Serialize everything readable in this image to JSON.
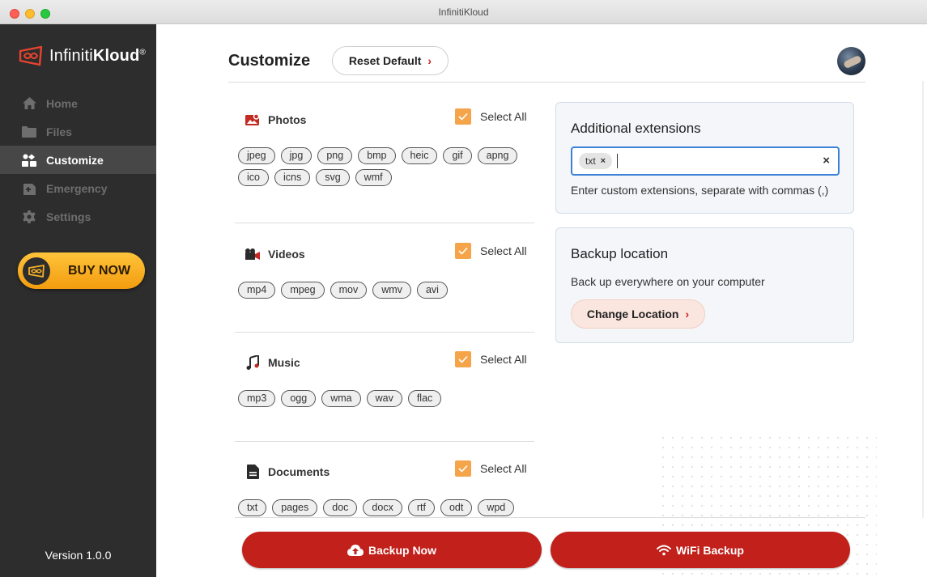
{
  "window": {
    "title": "InfinitiKloud"
  },
  "brand": {
    "name_light": "Infiniti",
    "name_bold": "Kloud",
    "mark": "®"
  },
  "sidebar": {
    "items": [
      {
        "label": "Home",
        "icon": "home-icon",
        "active": false
      },
      {
        "label": "Files",
        "icon": "folder-icon",
        "active": false
      },
      {
        "label": "Customize",
        "icon": "customize-icon",
        "active": true
      },
      {
        "label": "Emergency",
        "icon": "emergency-icon",
        "active": false
      },
      {
        "label": "Settings",
        "icon": "gear-icon",
        "active": false
      }
    ],
    "buy_label": "BUY NOW",
    "version": "Version 1.0.0"
  },
  "header": {
    "title": "Customize",
    "reset_label": "Reset Default",
    "chevron": "›"
  },
  "categories": [
    {
      "name": "Photos",
      "icon": "photo-icon",
      "select_all": "Select All",
      "checked": true,
      "tags": [
        "jpeg",
        "jpg",
        "png",
        "bmp",
        "heic",
        "gif",
        "apng",
        "ico",
        "icns",
        "svg",
        "wmf"
      ]
    },
    {
      "name": "Videos",
      "icon": "video-icon",
      "select_all": "Select All",
      "checked": true,
      "tags": [
        "mp4",
        "mpeg",
        "mov",
        "wmv",
        "avi"
      ]
    },
    {
      "name": "Music",
      "icon": "music-icon",
      "select_all": "Select All",
      "checked": true,
      "tags": [
        "mp3",
        "ogg",
        "wma",
        "wav",
        "flac"
      ]
    },
    {
      "name": "Documents",
      "icon": "document-icon",
      "select_all": "Select All",
      "checked": true,
      "tags": [
        "txt",
        "pages",
        "doc",
        "docx",
        "rtf",
        "odt",
        "wpd"
      ]
    }
  ],
  "extensions": {
    "title": "Additional extensions",
    "chips": [
      "txt"
    ],
    "chip_remove": "×",
    "clear": "×",
    "hint": "Enter custom extensions, separate with commas (,)"
  },
  "backup_location": {
    "title": "Backup location",
    "description": "Back up everywhere on your computer",
    "button_label": "Change Location",
    "chevron": "›"
  },
  "actions": {
    "backup_now": "Backup Now",
    "wifi_backup": "WiFi Backup"
  },
  "colors": {
    "accent_red": "#c1201b",
    "checkbox_orange": "#f5a44a",
    "sidebar_bg": "#2d2d2d",
    "buy_gold": "#f5b025"
  }
}
